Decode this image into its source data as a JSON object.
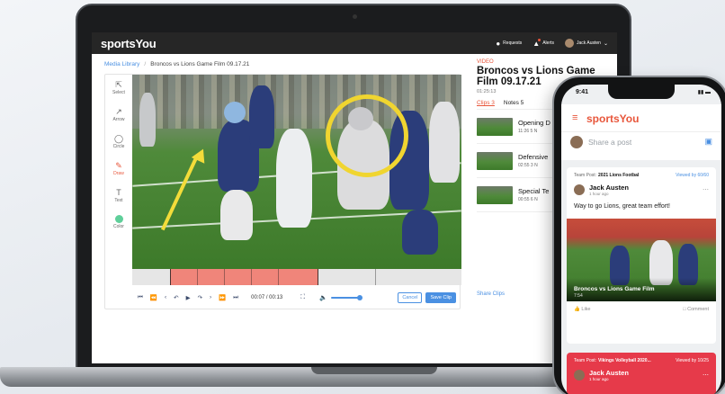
{
  "app": {
    "brand": "sportsYou",
    "header": {
      "requests": "Requests",
      "alerts": "Alerts",
      "user": "Jack Austen"
    }
  },
  "breadcrumb": {
    "parent": "Media Library",
    "separator": "/",
    "current": "Broncos vs Lions Game Film 09.17.21"
  },
  "tools": [
    {
      "label": "Select",
      "icon": "cursor-icon"
    },
    {
      "label": "Arrow",
      "icon": "arrow-icon"
    },
    {
      "label": "Circle",
      "icon": "circle-icon"
    },
    {
      "label": "Draw",
      "icon": "pencil-icon"
    },
    {
      "label": "Text",
      "icon": "text-icon"
    },
    {
      "label": "Color",
      "icon": "color-swatch-icon"
    }
  ],
  "player": {
    "time": "00:07 / 00:13",
    "buttons": [
      "⏮",
      "⏪",
      "‹",
      "↶",
      "▶",
      "↷",
      "›",
      "⏩",
      "⏭"
    ],
    "cancel": "Cancel",
    "save": "Save Clip",
    "volume": 0.75
  },
  "panel": {
    "label": "VIDEO",
    "title": "Broncos vs Lions Game Film 09.17.21",
    "duration": "01:25:13",
    "tabs": [
      "Clips 3",
      "Notes 5"
    ],
    "clips": [
      {
        "name": "Opening D",
        "meta": "11:26  5 N"
      },
      {
        "name": "Defensive",
        "meta": "02:55  3 N"
      },
      {
        "name": "Special Te",
        "meta": "00:55  6 N"
      }
    ],
    "share": "Share Clips"
  },
  "phone": {
    "time": "9:41",
    "brand": "sportsYou",
    "share_placeholder": "Share a post",
    "post1": {
      "team_label": "Team Post:",
      "team": "2021 Lions Footbal",
      "viewed": "Viewed by 60/60",
      "author": "Jack Austen",
      "time": "1 hour ago",
      "text": "Way to go Lions, great team effort!",
      "media_title": "Broncos vs Lions Game Film",
      "media_duration": "7:54",
      "like": "Like",
      "comment": "Comment"
    },
    "post2": {
      "team_label": "Team Post:",
      "team": "Vikings Volleyball 2020...",
      "viewed": "Viewed by 10/25",
      "author": "Jack Austen",
      "time": "1 hour ago"
    }
  },
  "colors": {
    "accent": "#e8563b",
    "link": "#4a90e2",
    "annotation": "#f0d530",
    "selection": "#f0857a"
  }
}
